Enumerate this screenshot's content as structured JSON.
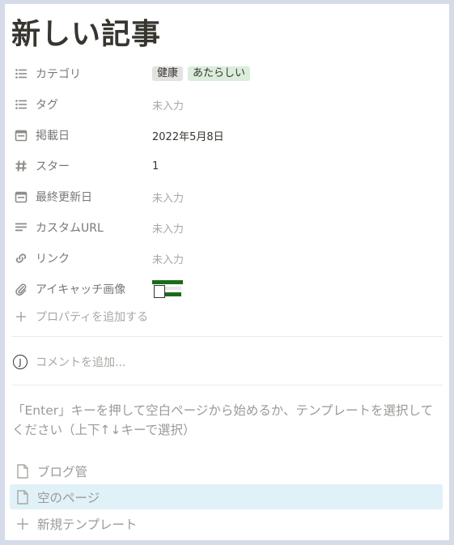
{
  "page": {
    "title": "新しい記事"
  },
  "properties": [
    {
      "icon": "list-icon",
      "name": "カテゴリ",
      "type": "tags",
      "tags": [
        {
          "label": "健康",
          "color": "#e3e2e0"
        },
        {
          "label": "あたらしい",
          "color": "#dbeddb"
        }
      ]
    },
    {
      "icon": "list-icon",
      "name": "タグ",
      "type": "empty",
      "value": "未入力"
    },
    {
      "icon": "calendar-icon",
      "name": "掲載日",
      "type": "text",
      "value": "2022年5月8日"
    },
    {
      "icon": "hash-icon",
      "name": "スター",
      "type": "text",
      "value": "1"
    },
    {
      "icon": "calendar-icon",
      "name": "最終更新日",
      "type": "empty",
      "value": "未入力"
    },
    {
      "icon": "text-lines-icon",
      "name": "カスタムURL",
      "type": "empty",
      "value": "未入力"
    },
    {
      "icon": "link-icon",
      "name": "リンク",
      "type": "empty",
      "value": "未入力"
    },
    {
      "icon": "paperclip-icon",
      "name": "アイキャッチ画像",
      "type": "image"
    }
  ],
  "add_property": {
    "label": "プロパティを追加する"
  },
  "comment": {
    "avatar_initial": "J",
    "placeholder": "コメントを追加..."
  },
  "hint": {
    "text": "「Enter」キーを押して空白ページから始めるか、テンプレートを選択してください（上下↑↓キーで選択）"
  },
  "templates": [
    {
      "icon": "page-icon",
      "label": "ブログ管",
      "selected": false
    },
    {
      "icon": "page-icon",
      "label": "空のページ",
      "selected": true
    },
    {
      "icon": "plus-icon",
      "label": "新規テンプレート",
      "selected": false
    }
  ]
}
